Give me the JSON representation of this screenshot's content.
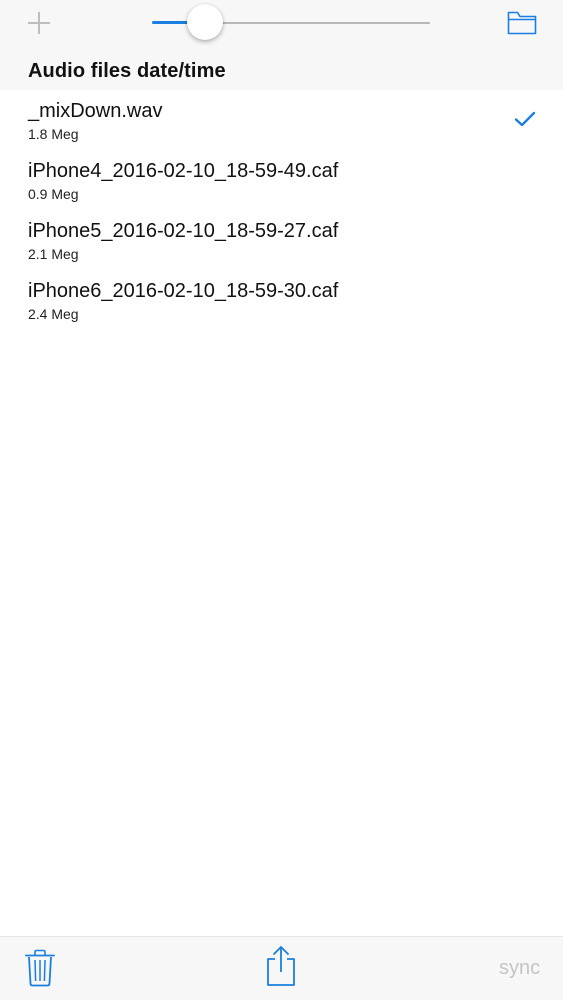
{
  "toolbar": {
    "add_icon": "plus-icon",
    "folder_icon": "folder-icon",
    "zoom_slider": {
      "value": 0.19,
      "accent_color": "#1a7fe0",
      "track_color": "#b8b8b8"
    }
  },
  "list": {
    "header": "Audio files date/time",
    "files": [
      {
        "name": "_mixDown.wav",
        "size": "1.8 Meg",
        "selected": true
      },
      {
        "name": "iPhone4_2016-02-10_18-59-49.caf",
        "size": "0.9 Meg",
        "selected": false
      },
      {
        "name": "iPhone5_2016-02-10_18-59-27.caf",
        "size": "2.1 Meg",
        "selected": false
      },
      {
        "name": "iPhone6_2016-02-10_18-59-30.caf",
        "size": "2.4 Meg",
        "selected": false
      }
    ],
    "selection_icon": "checkmark-icon"
  },
  "bottom_bar": {
    "trash_icon": "trash-icon",
    "share_icon": "share-icon",
    "sync_label": "sync"
  },
  "colors": {
    "accent": "#1a7fe0",
    "bar_background": "#f7f7f7",
    "disabled_text": "#c4c4c8",
    "muted_icon": "#bdbdbd"
  }
}
